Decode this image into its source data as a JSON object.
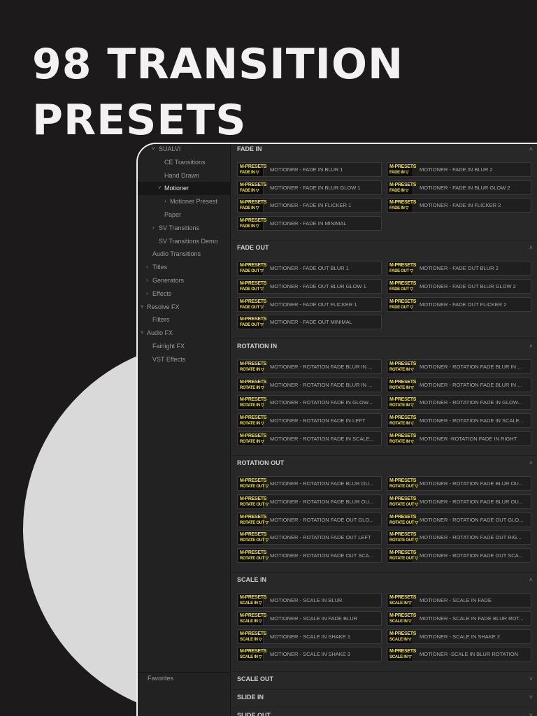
{
  "headline": {
    "line1": "98 TRANSITION",
    "line2": "PRESETS"
  },
  "sidebar": {
    "items": [
      {
        "label": "SUALVI",
        "arrow": "⌵"
      },
      {
        "label": "CE Transitions",
        "arrow": ""
      },
      {
        "label": "Hand Drawn",
        "arrow": ""
      },
      {
        "label": "Motioner",
        "arrow": "⌵"
      },
      {
        "label": "Motioner Presest",
        "arrow": ">"
      },
      {
        "label": "Paper",
        "arrow": ""
      },
      {
        "label": "SV Transitions",
        "arrow": ">"
      },
      {
        "label": "SV Transitions Demo",
        "arrow": ""
      },
      {
        "label": "Audio Transitions",
        "arrow": ""
      },
      {
        "label": "Titles",
        "arrow": ">"
      },
      {
        "label": "Generators",
        "arrow": ">"
      },
      {
        "label": "Effects",
        "arrow": ">"
      },
      {
        "label": "Resolve FX",
        "arrow": "⌵"
      },
      {
        "label": "Filters",
        "arrow": ""
      },
      {
        "label": "Audio FX",
        "arrow": "⌵"
      },
      {
        "label": "Fairlight FX",
        "arrow": ""
      },
      {
        "label": "VST Effects",
        "arrow": ""
      }
    ],
    "favorites": "Favorites"
  },
  "icons": {
    "expanded": "chevron-up-icon",
    "collapsed": "chevron-down-icon"
  },
  "accent_color": "#f5e52b",
  "sections": [
    {
      "title": "FADE IN",
      "expanded": true,
      "chev": "˄",
      "badge": [
        "M-PRESETS",
        "FADE IN ▽"
      ],
      "items": [
        "MOTIONER - FADE IN BLUR 1",
        "MOTIONER - FADE IN BLUR 2",
        "MOTIONER - FADE IN BLUR GLOW 1",
        "MOTIONER - FADE IN BLUR GLOW 2",
        "MOTIONER - FADE IN FLICKER 1",
        "MOTIONER - FADE IN FLICKER 2",
        "MOTIONER - FADE IN MINIMAL"
      ]
    },
    {
      "title": "FADE OUT",
      "expanded": true,
      "chev": "˄",
      "badge": [
        "M-PRESETS",
        "FADE OUT ▽"
      ],
      "items": [
        "MOTIONER - FADE OUT BLUR 1",
        "MOTIONER - FADE OUT BLUR 2",
        "MOTIONER - FADE OUT BLUR GLOW 1",
        "MOTIONER - FADE OUT BLUR GLOW 2",
        "MOTIONER - FADE OUT FLICKER 1",
        "MOTIONER - FADE OUT FLICKER 2",
        "MOTIONER - FADE OUT MINIMAL"
      ]
    },
    {
      "title": "ROTATION IN",
      "expanded": true,
      "chev": "˄",
      "badge": [
        "M-PRESETS",
        "ROTATE IN ▽"
      ],
      "items": [
        "MOTIONER - ROTATION FADE BLUR IN ...",
        "MOTIONER - ROTATION FADE BLUR IN ...",
        "MOTIONER - ROTATION FADE BLUR IN ...",
        "MOTIONER - ROTATION FADE BLUR IN ...",
        "MOTIONER - ROTATION FADE IN GLOW...",
        "MOTIONER - ROTATION FADE IN GLOW...",
        "MOTIONER - ROTATION FADE IN LEFT",
        "MOTIONER - ROTATION FADE IN SCALE...",
        "MOTIONER - ROTATION FADE IN SCALE...",
        "MOTIONER -ROTATION FADE IN RIGHT"
      ]
    },
    {
      "title": "ROTATION OUT",
      "expanded": true,
      "chev": "˄",
      "badge": [
        "M-PRESETS",
        "ROTATE OUT ▽"
      ],
      "items": [
        "MOTIONER - ROTATION FADE BLUR OU...",
        "MOTIONER - ROTATION FADE BLUR OU...",
        "MOTIONER - ROTATION FADE BLUR OU...",
        "MOTIONER - ROTATION FADE BLUR OU...",
        "MOTIONER - ROTATION FADE OUT GLO...",
        "MOTIONER - ROTATION FADE OUT GLO...",
        "MOTIONER - ROTATION FADE OUT LEFT",
        "MOTIONER - ROTATION FADE OUT RIG...",
        "MOTIONER - ROTATION FADE OUT SCA...",
        "MOTIONER - ROTATION FADE OUT SCA..."
      ]
    },
    {
      "title": "SCALE IN",
      "expanded": true,
      "chev": "˄",
      "badge": [
        "M-PRESETS",
        "SCALE IN ▽"
      ],
      "items": [
        "MOTIONER - SCALE IN BLUR",
        "MOTIONER - SCALE IN FADE",
        "MOTIONER - SCALE IN FADE BLUR",
        "MOTIONER - SCALE IN FADE BLUR ROT...",
        "MOTIONER - SCALE IN SHAKE 1",
        "MOTIONER - SCALE IN SHAKE 2",
        "MOTIONER - SCALE IN SHAKE 3",
        "MOTIONER -SCALE IN BLUR ROTATION"
      ]
    },
    {
      "title": "SCALE OUT",
      "expanded": false,
      "chev": "˅",
      "items": []
    },
    {
      "title": "SLIDE IN",
      "expanded": false,
      "chev": "˅",
      "items": []
    },
    {
      "title": "SLIDE OUT",
      "expanded": false,
      "chev": "˅",
      "items": []
    }
  ]
}
